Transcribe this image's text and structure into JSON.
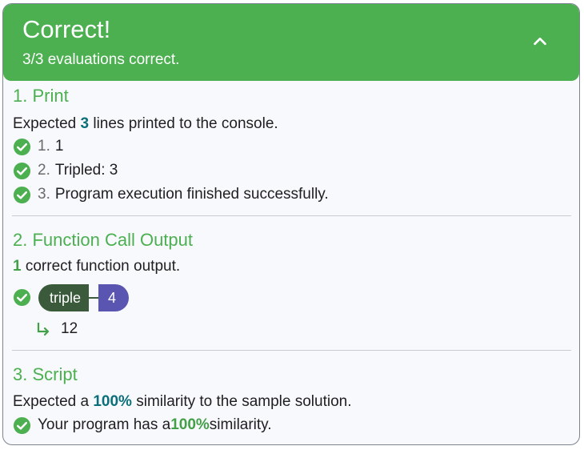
{
  "header": {
    "title": "Correct!",
    "subtitle": "3/3 evaluations correct.",
    "collapse_icon": "chevron-up-icon"
  },
  "colors": {
    "success": "#4caf50",
    "function_pill": "#3b5a3c",
    "argument_pill": "#5a55b0",
    "highlight": "#0b6f7a"
  },
  "sections": [
    {
      "title": "1. Print",
      "summary_pre": "Expected ",
      "summary_value": "3",
      "summary_post": " lines printed to the console.",
      "items": [
        {
          "num": "1.",
          "text": "1"
        },
        {
          "num": "2.",
          "text": "Tripled: 3"
        },
        {
          "num": "3.",
          "text": "Program execution finished successfully."
        }
      ]
    },
    {
      "title": "2. Function Call Output",
      "summary_value": "1",
      "summary_post": " correct function output.",
      "call": {
        "function": "triple",
        "argument": "4",
        "result": "12"
      }
    },
    {
      "title": "3. Script",
      "summary_pre": "Expected a ",
      "summary_value": "100%",
      "summary_post": " similarity to the sample solution.",
      "result_pre": "Your program has a ",
      "result_value": "100%",
      "result_post": " similarity."
    }
  ]
}
